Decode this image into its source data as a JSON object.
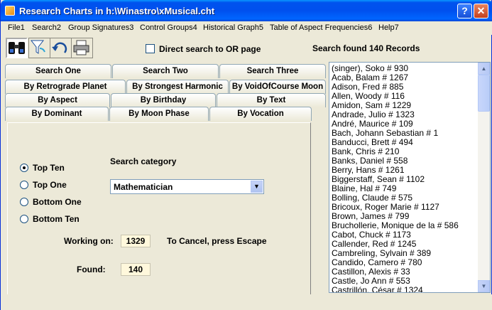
{
  "window": {
    "title": "Research Charts in h:\\Winastro\\xMusical.cht",
    "help_btn": "?",
    "close_btn": "✕"
  },
  "menu": [
    "File1",
    "Search2",
    "Group Signatures3",
    "Control Groups4",
    "Historical Graph5",
    "Table of Aspect Frequencies6",
    "Help7"
  ],
  "toolbar": {
    "direct_search_label": "Direct search to OR page",
    "direct_search_checked": false,
    "status": "Search found 140 Records"
  },
  "tabs": {
    "row1": [
      "Search One",
      "Search Two",
      "Search Three"
    ],
    "row2": [
      "By Retrograde Planet",
      "By Strongest Harmonic",
      "By VoidOfCourse Moon"
    ],
    "row3": [
      "By Aspect",
      "By Birthday",
      "By Text"
    ],
    "row4": [
      "By Dominant",
      "By Moon Phase",
      "By Vocation"
    ]
  },
  "panel": {
    "radios": [
      "Top Ten",
      "Top One",
      "Bottom One",
      "Bottom Ten"
    ],
    "selected_radio": "Top Ten",
    "category_label": "Search category",
    "category_value": "Mathematician",
    "working_label": "Working on:",
    "working_value": "1329",
    "cancel_hint": "To Cancel, press Escape",
    "found_label": "Found:",
    "found_value": "140"
  },
  "records": [
    "(singer), Soko  # 930",
    "Acab, Balam  # 1267",
    "Adison, Fred  # 885",
    "Allen, Woody  # 116",
    "Amidon, Sam  # 1229",
    "Andrade, Julio  # 1323",
    "André, Maurice  # 109",
    "Bach, Johann Sebastian  # 1",
    "Banducci, Brett  # 494",
    "Bank, Chris  # 210",
    "Banks, Daniel  # 558",
    "Berry, Hans  # 1261",
    "Biggerstaff, Sean  # 1102",
    "Blaine, Hal  # 749",
    "Bolling, Claude  # 575",
    "Bricoux, Roger Marie  # 1127",
    "Brown, James  # 799",
    "Bruchollerie, Monique de la  # 586",
    "Cabot, Chuck  # 1173",
    "Callender, Red  # 1245",
    "Cambreling, Sylvain  # 389",
    "Candido, Camero  # 780",
    "Castillon, Alexis  # 33",
    "Castle, Jo Ann  # 553",
    "Castrillón, César  # 1324"
  ]
}
